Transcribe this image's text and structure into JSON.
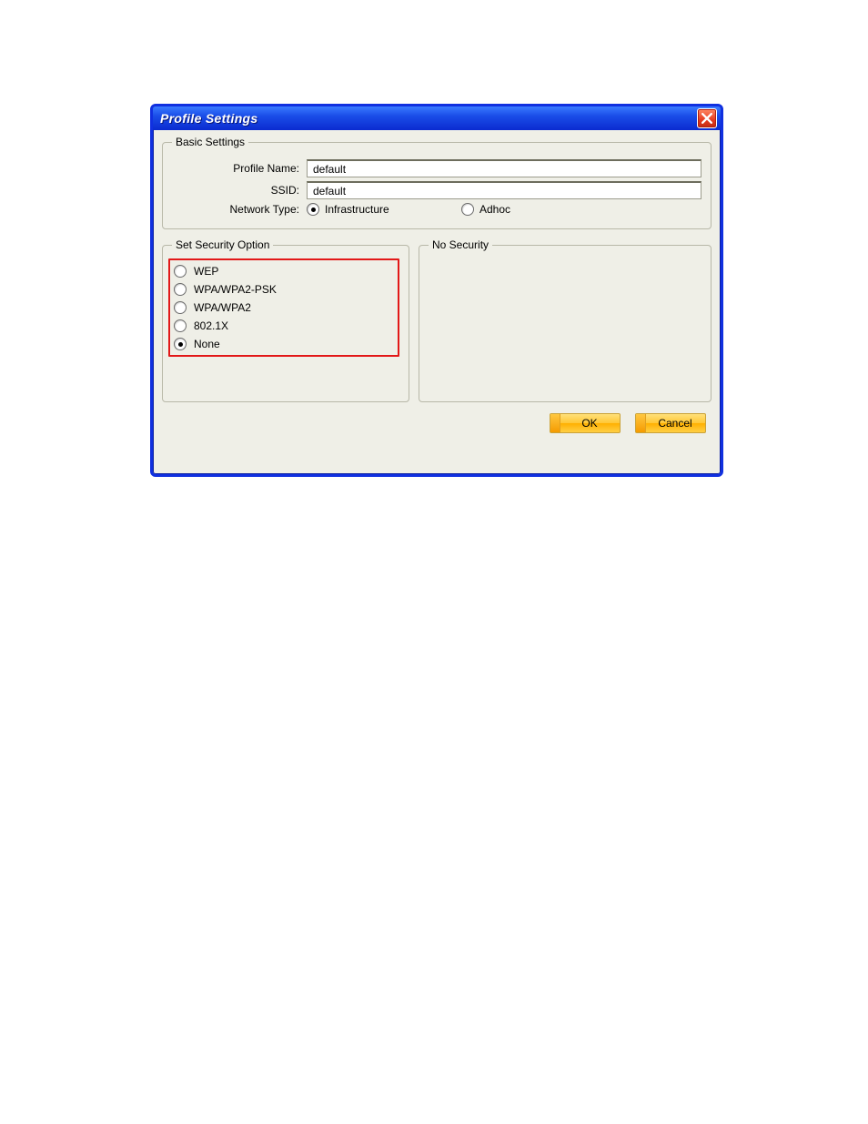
{
  "window": {
    "title": "Profile Settings"
  },
  "basic": {
    "legend": "Basic Settings",
    "profile_name_label": "Profile Name:",
    "profile_name_value": "default",
    "ssid_label": "SSID:",
    "ssid_value": "default",
    "network_type_label": "Network Type:",
    "network_type_options": {
      "infrastructure": "Infrastructure",
      "adhoc": "Adhoc"
    },
    "network_type_selected": "infrastructure"
  },
  "security": {
    "legend": "Set Security Option",
    "options": {
      "wep": "WEP",
      "wpa_psk": "WPA/WPA2-PSK",
      "wpa": "WPA/WPA2",
      "dot1x": "802.1X",
      "none": "None"
    },
    "selected": "none"
  },
  "nosecurity": {
    "legend": "No Security"
  },
  "buttons": {
    "ok": "OK",
    "cancel": "Cancel"
  }
}
